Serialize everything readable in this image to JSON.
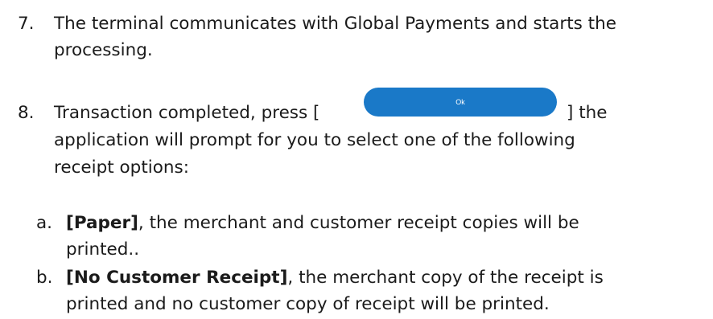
{
  "steps": [
    {
      "number": "7.",
      "line1": "The terminal communicates with Global Payments and starts the",
      "line2": "processing."
    },
    {
      "number": "8.",
      "line1_before": "Transaction completed, press [",
      "button_label": "Ok",
      "line1_after": "]  the",
      "line2": "application will prompt for you to select one of the following",
      "line3": "receipt options:"
    }
  ],
  "options": [
    {
      "letter": "a.",
      "bold": "[Paper]",
      "line1_rest": ", the merchant and customer receipt copies will be",
      "line2": "printed.."
    },
    {
      "letter": "b.",
      "bold": "[No Customer Receipt]",
      "line1_rest": ", the merchant copy of the receipt is",
      "line2": "printed and no customer copy of receipt will be printed."
    }
  ],
  "colors": {
    "button": "#1a79c8",
    "text": "#1b1b1b"
  }
}
